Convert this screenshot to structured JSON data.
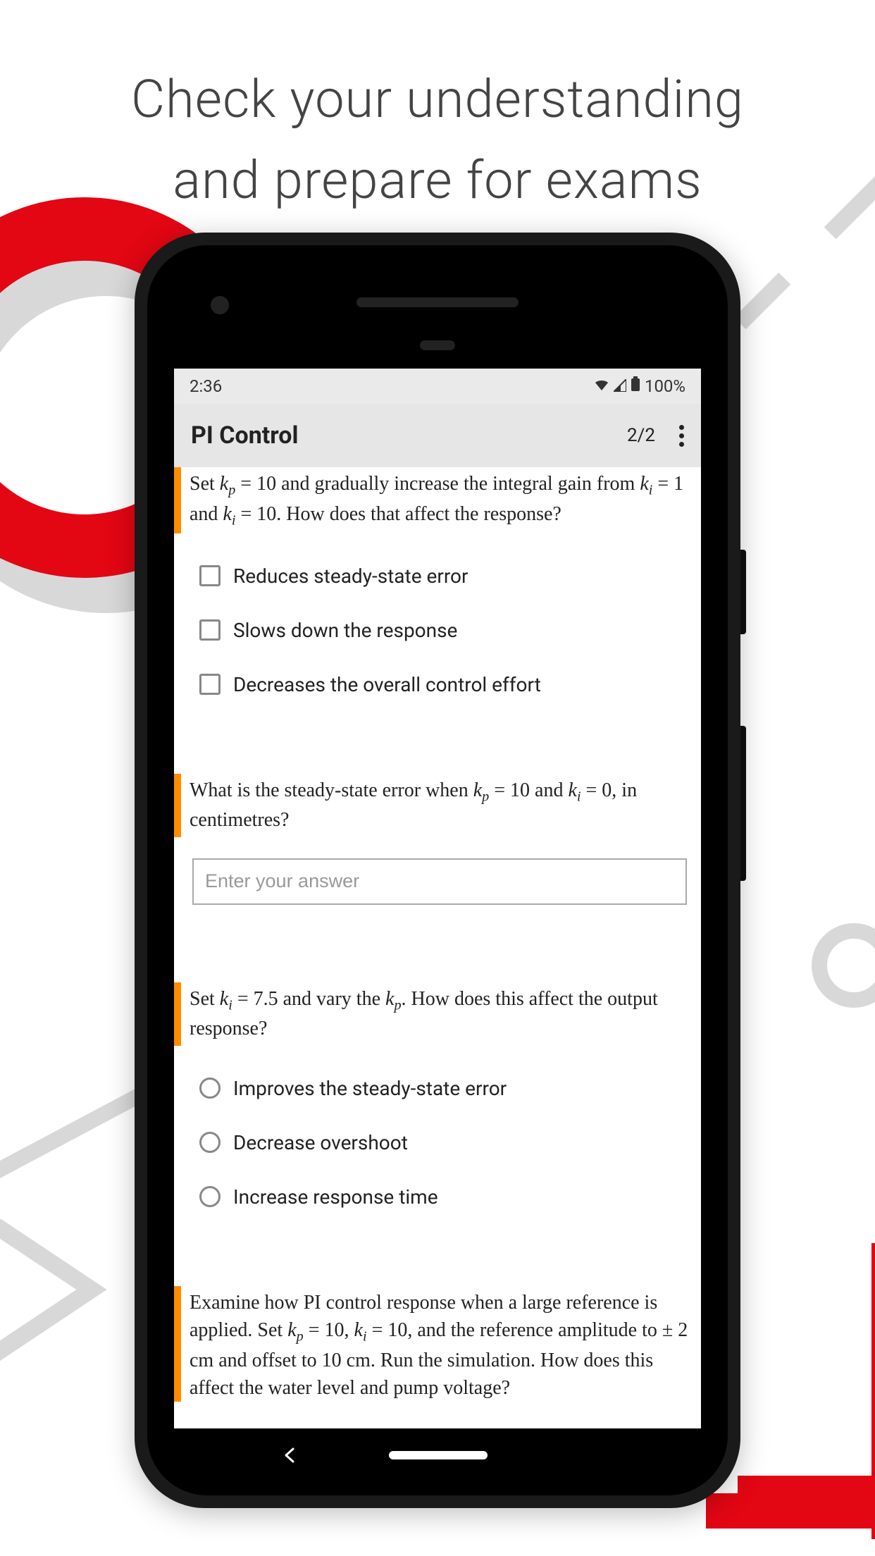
{
  "header": {
    "line1": "Check your understanding",
    "line2": "and prepare for exams"
  },
  "statusBar": {
    "time": "2:36",
    "battery": "100%"
  },
  "appBar": {
    "title": "PI Control",
    "pageCounter": "2/2"
  },
  "questions": [
    {
      "type": "checkbox",
      "prompt_html": "Set <em>k<span class='sub'>p</span></em> = 10 and gradually increase the integral gain from <em>k<span class='sub'>i</span></em> = 1 and <em>k<span class='sub'>i</span></em> = 10. How does that affect the response?",
      "options": [
        "Reduces steady-state error",
        "Slows down the response",
        "Decreases the overall control effort"
      ]
    },
    {
      "type": "input",
      "prompt_html": "What is the steady-state error when <em>k<span class='sub'>p</span></em> = 10 and <em>k<span class='sub'>i</span></em> = 0, in centimetres?",
      "placeholder": "Enter your answer"
    },
    {
      "type": "radio",
      "prompt_html": "Set <em>k<span class='sub'>i</span></em> = 7.5 and vary the <em>k<span class='sub'>p</span></em>. How does this affect the output response?",
      "options": [
        "Improves the steady-state error",
        "Decrease overshoot",
        "Increase response time"
      ]
    },
    {
      "type": "text",
      "prompt_html": "Examine how PI control response when a large reference is applied. Set <em>k<span class='sub'>p</span></em> = 10, <em>k<span class='sub'>i</span></em> = 10, and the reference amplitude to ± 2 cm and offset to 10 cm. Run the simulation. How does this affect the water level and pump voltage?"
    }
  ]
}
